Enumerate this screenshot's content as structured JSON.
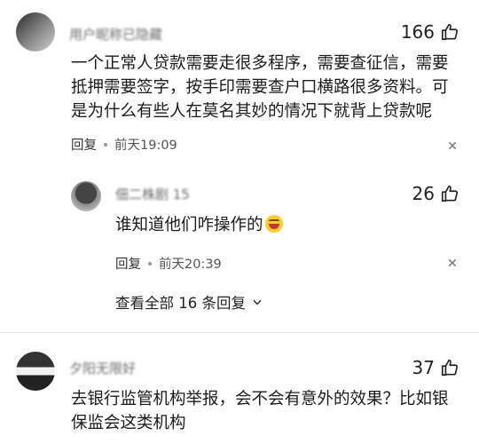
{
  "comments": [
    {
      "username": "用户昵称已隐藏",
      "likes": "166",
      "text": "一个正常人贷款需要走很多程序，需要查征信，需要抵押需要签字，按手印需要查户口横路很多资料。可是为什么有些人在莫名其妙的情况下就背上贷款呢",
      "reply_label": "回复",
      "time": "前天19:09"
    },
    {
      "username": "佃二株剧 15",
      "likes": "26",
      "text": "谁知道他们咋操作的",
      "emoji": "laughing-emoji",
      "reply_label": "回复",
      "time": "前天20:39"
    },
    {
      "username": "夕阳无限好",
      "likes": "37",
      "text": "去银行监管机构举报，会不会有意外的效果？比如银保监会这类机构"
    }
  ],
  "view_all": "查看全部 16 条回复",
  "icons": {
    "like": "thumbs-up-icon",
    "more": "more-options-icon",
    "chevron": "chevron-down-icon"
  }
}
